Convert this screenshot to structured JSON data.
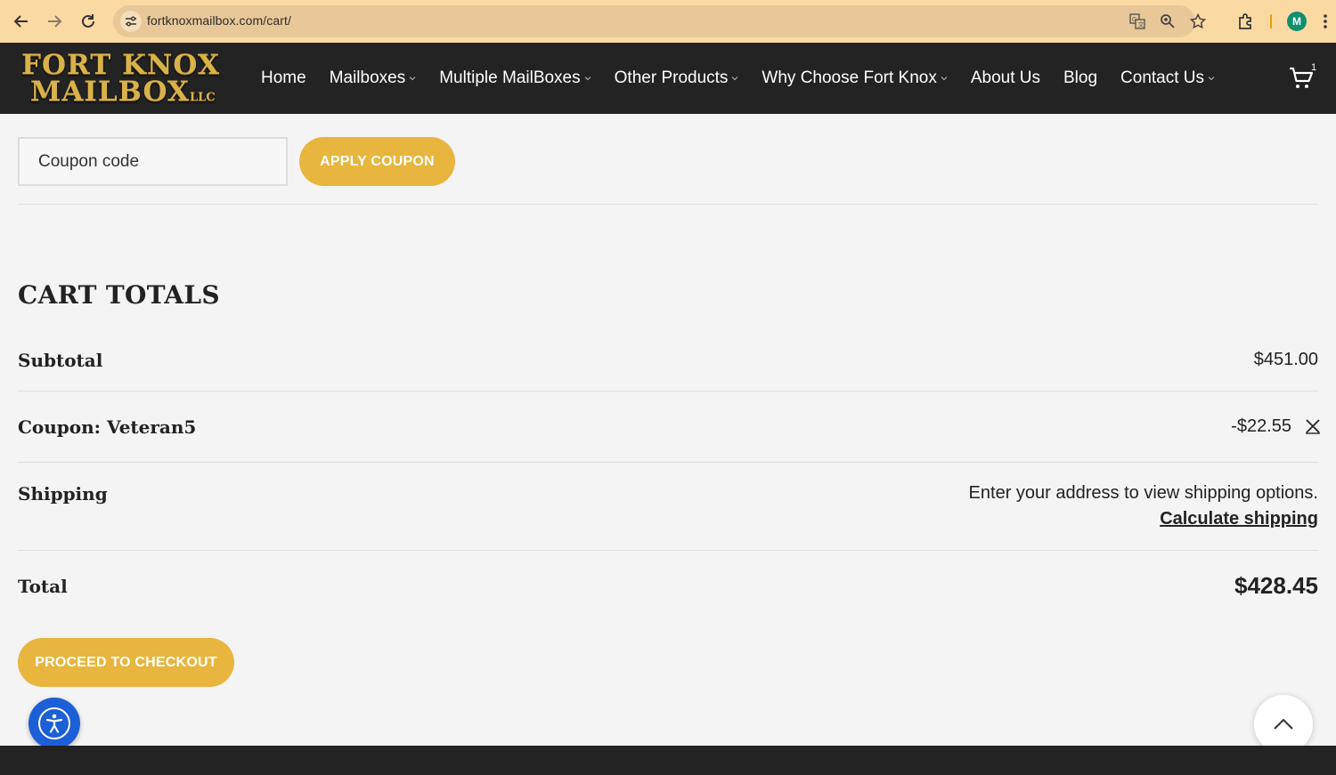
{
  "browser": {
    "url": "fortknoxmailbox.com/cart/",
    "profile_initial": "M",
    "icons": [
      "back-arrow-icon",
      "forward-arrow-icon",
      "reload-icon",
      "site-info-icon",
      "translate-icon",
      "zoom-icon",
      "bookmark-star-icon",
      "extensions-icon",
      "more-menu-icon"
    ],
    "chrome_color": "#fbd9a3"
  },
  "header": {
    "logo_line1": "FORT KNOX",
    "logo_line2": "MAILBOX",
    "logo_suffix": "LLC",
    "nav": [
      {
        "label": "Home",
        "dropdown": false
      },
      {
        "label": "Mailboxes",
        "dropdown": true
      },
      {
        "label": "Multiple MailBoxes",
        "dropdown": true
      },
      {
        "label": "Other Products",
        "dropdown": true
      },
      {
        "label": "Why Choose Fort Knox",
        "dropdown": true
      },
      {
        "label": "About Us",
        "dropdown": false
      },
      {
        "label": "Blog",
        "dropdown": false
      },
      {
        "label": "Contact Us",
        "dropdown": true
      }
    ],
    "cart_count": "1"
  },
  "coupon": {
    "placeholder": "Coupon code",
    "apply_label": "APPLY COUPON"
  },
  "totals": {
    "title": "CART TOTALS",
    "subtotal_label": "Subtotal",
    "subtotal_value": "$451.00",
    "coupon_label": "Coupon: Veteran5",
    "coupon_value": "-$22.55",
    "shipping_label": "Shipping",
    "shipping_text": "Enter your address to view shipping options.",
    "calculate_link": "Calculate shipping",
    "total_label": "Total",
    "total_value": "$428.45"
  },
  "checkout_label": "PROCEED TO CHECKOUT",
  "colors": {
    "accent": "#e8b53e",
    "header_bg": "#232323",
    "accessibility_blue": "#1d5fd6"
  }
}
